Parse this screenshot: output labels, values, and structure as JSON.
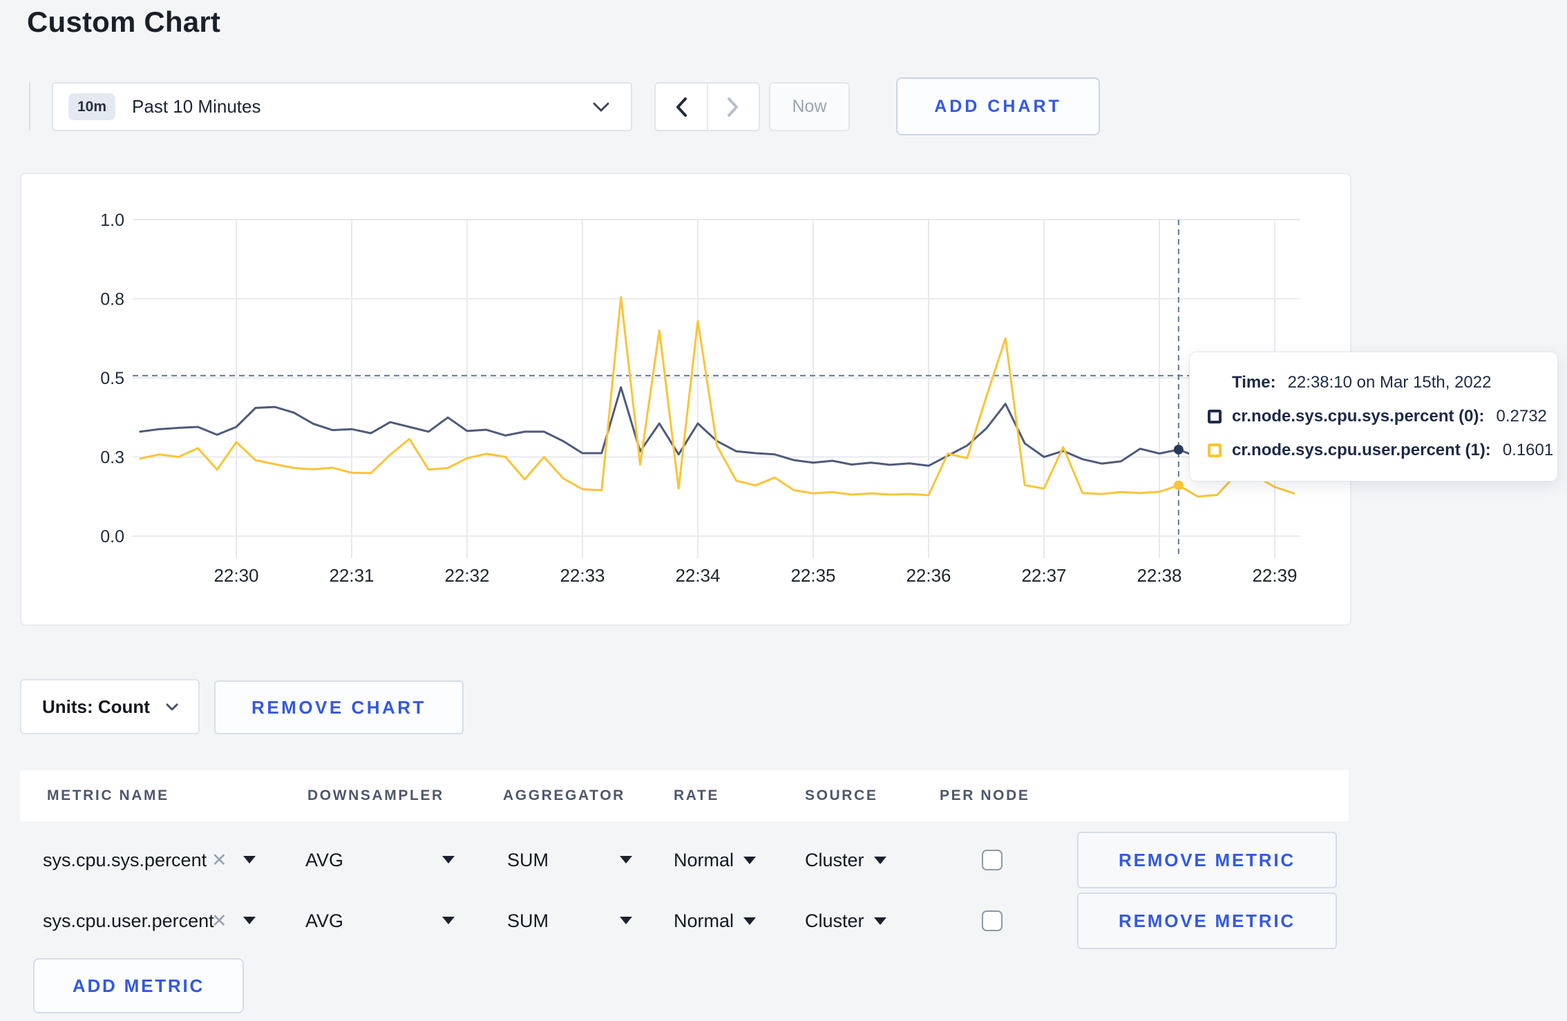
{
  "page": {
    "title": "Custom Chart",
    "background": "#f4f5f7",
    "accent_blue": "#3358e4"
  },
  "icons": {
    "clear": "✕"
  },
  "toolbar": {
    "range_badge": "10m",
    "range_label": "Past 10 Minutes",
    "now_label": "Now",
    "add_chart_label": "ADD CHART"
  },
  "chart_data": {
    "type": "line",
    "title": "",
    "x_tick_labels": [
      "22:30",
      "22:31",
      "22:32",
      "22:33",
      "22:34",
      "22:35",
      "22:36",
      "22:37",
      "22:38",
      "22:39"
    ],
    "y_ticks": [
      {
        "value": 0,
        "label": "0.0"
      },
      {
        "value": 0.25,
        "label": "0.3"
      },
      {
        "value": 0.5,
        "label": "0.5"
      },
      {
        "value": 0.75,
        "label": "0.8"
      },
      {
        "value": 1,
        "label": "1.0"
      }
    ],
    "ylim": [
      0,
      1
    ],
    "grid": true,
    "legend_position": "none",
    "sample_interval_minutes": 0.1666667,
    "first_sample_offset_minutes": -0.8333333,
    "series": [
      {
        "name": "cr.node.sys.cpu.sys.percent",
        "color": "#4d5b7c",
        "values": [
          0.33,
          0.338,
          0.342,
          0.345,
          0.32,
          0.345,
          0.405,
          0.408,
          0.39,
          0.355,
          0.335,
          0.338,
          0.325,
          0.36,
          0.345,
          0.33,
          0.375,
          0.332,
          0.336,
          0.318,
          0.33,
          0.33,
          0.3,
          0.262,
          0.262,
          0.47,
          0.268,
          0.356,
          0.258,
          0.356,
          0.3,
          0.268,
          0.262,
          0.258,
          0.24,
          0.232,
          0.238,
          0.226,
          0.232,
          0.225,
          0.23,
          0.222,
          0.254,
          0.286,
          0.34,
          0.418,
          0.293,
          0.25,
          0.269,
          0.243,
          0.229,
          0.236,
          0.276,
          0.261,
          0.2732,
          0.25,
          0.252,
          0.248,
          0.252,
          0.25,
          0.252
        ]
      },
      {
        "name": "cr.node.sys.cpu.user.percent",
        "color": "#fbc437",
        "values": [
          0.245,
          0.258,
          0.25,
          0.278,
          0.21,
          0.297,
          0.24,
          0.227,
          0.215,
          0.211,
          0.216,
          0.2,
          0.199,
          0.257,
          0.307,
          0.21,
          0.215,
          0.246,
          0.26,
          0.25,
          0.179,
          0.25,
          0.182,
          0.148,
          0.145,
          0.755,
          0.225,
          0.65,
          0.15,
          0.68,
          0.285,
          0.175,
          0.16,
          0.185,
          0.145,
          0.135,
          0.139,
          0.131,
          0.135,
          0.131,
          0.133,
          0.129,
          0.261,
          0.246,
          0.44,
          0.625,
          0.161,
          0.15,
          0.281,
          0.136,
          0.133,
          0.139,
          0.136,
          0.14,
          0.1601,
          0.125,
          0.13,
          0.195,
          0.19,
          0.155,
          0.135
        ]
      }
    ],
    "crosshair": {
      "time": "22:38:10",
      "offset_minutes": 8.1666667,
      "y_value": 0.507,
      "color": "#5d7792"
    },
    "highlights": [
      {
        "series_index": 0,
        "value": 0.2732,
        "color": "#2c3a5c"
      },
      {
        "series_index": 1,
        "value": 0.1601,
        "color": "#fbc437"
      }
    ]
  },
  "tooltip": {
    "time_label": "Time:",
    "time_value": "22:38:10 on Mar 15th, 2022",
    "entries": [
      {
        "label": "cr.node.sys.cpu.sys.percent (0):",
        "value": "0.2732",
        "swatch_color": "#1e2b4d"
      },
      {
        "label": "cr.node.sys.cpu.user.percent (1):",
        "value": "0.1601",
        "swatch_color": "#fdc42f"
      }
    ]
  },
  "chart_controls": {
    "units_label": "Units: Count",
    "remove_chart_label": "REMOVE CHART"
  },
  "metrics_table": {
    "headers": [
      "METRIC NAME",
      "DOWNSAMPLER",
      "AGGREGATOR",
      "RATE",
      "SOURCE",
      "PER NODE"
    ],
    "rows": [
      {
        "metric": "sys.cpu.sys.percent",
        "downsampler": "AVG",
        "aggregator": "SUM",
        "rate": "Normal",
        "source": "Cluster",
        "per_node_checked": false,
        "remove_label": "REMOVE METRIC"
      },
      {
        "metric": "sys.cpu.user.percent",
        "downsampler": "AVG",
        "aggregator": "SUM",
        "rate": "Normal",
        "source": "Cluster",
        "per_node_checked": false,
        "remove_label": "REMOVE METRIC"
      }
    ],
    "add_metric_label": "ADD METRIC"
  }
}
